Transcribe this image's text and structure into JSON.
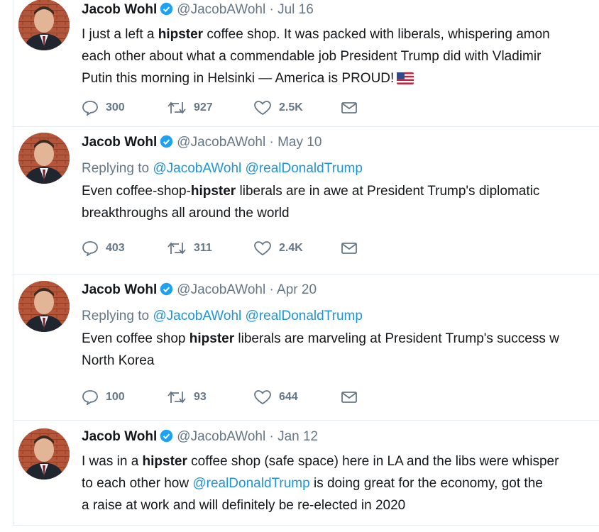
{
  "tweets": [
    {
      "name": "Jacob Wohl",
      "handle": "@JacobAWohl",
      "sep": "·",
      "date": "Jul 16",
      "text_lines": [
        [
          "I just a left a ",
          "hipster",
          " coffee shop. It was packed with liberals, whispering amon"
        ],
        [
          "each other about what a commendable job President Trump did with Vladimir"
        ],
        [
          "Putin this morning in Helsinki — America is PROUD!"
        ]
      ],
      "replies": "300",
      "retweets": "927",
      "likes": "2.5K"
    },
    {
      "name": "Jacob Wohl",
      "handle": "@JacobAWohl",
      "sep": "·",
      "date": "May 10",
      "replying_label": "Replying to",
      "mention_1": "@JacobAWohl",
      "mention_2": "@realDonaldTrump",
      "text_lines": [
        [
          "Even coffee-shop-",
          "hipster",
          " liberals are in awe at President Trump's diplomatic"
        ],
        [
          "breakthroughs all around the world"
        ]
      ],
      "replies": "403",
      "retweets": "311",
      "likes": "2.4K"
    },
    {
      "name": "Jacob Wohl",
      "handle": "@JacobAWohl",
      "sep": "·",
      "date": "Apr 20",
      "replying_label": "Replying to",
      "mention_1": "@JacobAWohl",
      "mention_2": "@realDonaldTrump",
      "text_lines": [
        [
          "Even coffee shop ",
          "hipster",
          " liberals are marveling at President Trump's success w"
        ],
        [
          "North Korea"
        ]
      ],
      "replies": "100",
      "retweets": "93",
      "likes": "644"
    },
    {
      "name": "Jacob Wohl",
      "handle": "@JacobAWohl",
      "sep": "·",
      "date": "Jan 12",
      "text_lines": [
        [
          "I was in a ",
          "hipster",
          " coffee shop (safe space) here in LA and the libs were whisper"
        ],
        [
          "to each other how ",
          "@realDonaldTrump",
          " is doing great for the economy, got the"
        ],
        [
          "a raise at work and will definitely be re-elected in 2020"
        ]
      ]
    }
  ],
  "colors": {
    "text": "#14171a",
    "secondary": "#657786",
    "link": "#1b95e0",
    "verified": "#1da1f2",
    "divider": "#e6ecf0"
  },
  "icons": [
    "verified-badge-icon",
    "reply-icon",
    "retweet-icon",
    "like-icon",
    "direct-message-icon",
    "us-flag-emoji-icon"
  ]
}
